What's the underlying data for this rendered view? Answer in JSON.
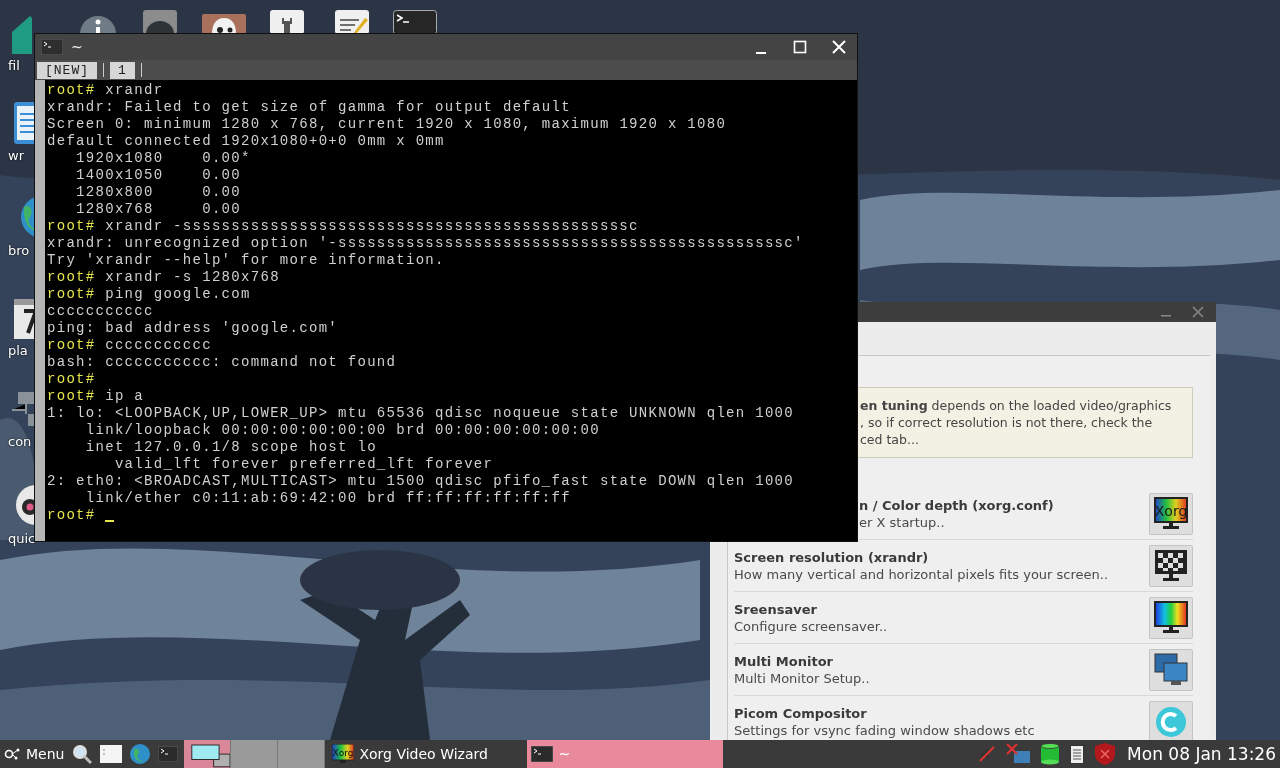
{
  "desktop_icons": [
    {
      "label": "fil"
    },
    {
      "label": "wr"
    },
    {
      "label": "bro"
    },
    {
      "label": "pla"
    },
    {
      "label": "con"
    },
    {
      "label": "quic"
    }
  ],
  "terminal": {
    "title": "~",
    "tabs": [
      {
        "label": "[NEW]"
      },
      {
        "label": "1"
      }
    ],
    "lines": [
      {
        "prompt": "root#",
        "text": "xrandr"
      },
      {
        "text": "xrandr: Failed to get size of gamma for output default"
      },
      {
        "text": "Screen 0: minimum 1280 x 768, current 1920 x 1080, maximum 1920 x 1080"
      },
      {
        "text": "default connected 1920x1080+0+0 0mm x 0mm"
      },
      {
        "text": "   1920x1080    0.00*"
      },
      {
        "text": "   1400x1050    0.00"
      },
      {
        "text": "   1280x800     0.00"
      },
      {
        "text": "   1280x768     0.00"
      },
      {
        "prompt": "root#",
        "text": "xrandr -ssssssssssssssssssssssssssssssssssssssssssssssc"
      },
      {
        "text": "xrandr: unrecognized option '-ssssssssssssssssssssssssssssssssssssssssssssssc'"
      },
      {
        "text": "Try 'xrandr --help' for more information."
      },
      {
        "prompt": "root#",
        "text": "xrandr -s 1280x768"
      },
      {
        "prompt": "root#",
        "text": "ping google.com"
      },
      {
        "text": "ccccccccccc"
      },
      {
        "text": "ping: bad address 'google.com'"
      },
      {
        "prompt": "root#",
        "text": "ccccccccccc"
      },
      {
        "text": "bash: ccccccccccc: command not found"
      },
      {
        "prompt": "root#"
      },
      {
        "prompt": "root#",
        "text": "ip a"
      },
      {
        "text": "1: lo: <LOOPBACK,UP,LOWER_UP> mtu 65536 qdisc noqueue state UNKNOWN qlen 1000"
      },
      {
        "text": "    link/loopback 00:00:00:00:00:00 brd 00:00:00:00:00:00"
      },
      {
        "text": "    inet 127.0.0.1/8 scope host lo"
      },
      {
        "text": "       valid_lft forever preferred_lft forever"
      },
      {
        "text": "2: eth0: <BROADCAST,MULTICAST> mtu 1500 qdisc pfifo_fast state DOWN qlen 1000"
      },
      {
        "text": "    link/ether c0:11:ab:69:42:00 brd ff:ff:ff:ff:ff:ff"
      },
      {
        "prompt": "root#"
      }
    ],
    "cursor": true
  },
  "wizard": {
    "info_lines": [
      "**en tuning** depends on the loaded video/graphics",
      ", so if correct resolution is not there, check the",
      "ced tab..."
    ],
    "rows": [
      {
        "title": "n / Color depth (xorg.conf)",
        "description": "er X startup..",
        "kind": "xorg",
        "icon_text": "Xorg"
      },
      {
        "title": "Screen resolution (xrandr)",
        "description": "How many vertical and horizontal pixels fits your screen..",
        "kind": "checker"
      },
      {
        "title": "Sreensaver",
        "description": "Configure screensaver..",
        "kind": "rainbow"
      },
      {
        "title": "Multi Monitor",
        "description": "Multi Monitor Setup..",
        "kind": "monitors"
      },
      {
        "title": "Picom Compositor",
        "description": "Settings for vsync fading window shadows etc",
        "kind": "picom"
      }
    ]
  },
  "taskbar": {
    "menu_label": "Menu",
    "workspaces": [
      {
        "selected": true
      },
      {
        "selected": false
      },
      {
        "selected": false
      }
    ],
    "tasks": [
      {
        "title": "Xorg Video Wizard",
        "kind": "xorg",
        "icon_text": "Xorg",
        "selected": false
      },
      {
        "title": "~",
        "kind": "terminal",
        "selected": true
      }
    ],
    "clock": "Mon 08 Jan 13:26"
  }
}
